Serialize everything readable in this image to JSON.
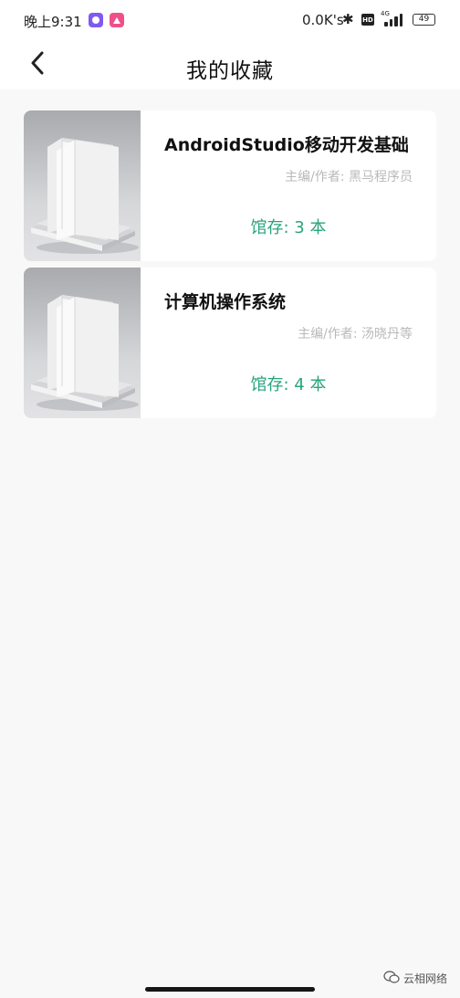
{
  "status_bar": {
    "time": "晚上9:31",
    "network_speed": "0.0K's",
    "hd_label": "HD",
    "network_type": "4G",
    "battery_level": "49"
  },
  "header": {
    "title": "我的收藏"
  },
  "books": [
    {
      "title": "AndroidStudio移动开发基础",
      "author": "主编/作者: 黑马程序员",
      "stock": "馆存: 3 本"
    },
    {
      "title": "计算机操作系统",
      "author": "主编/作者: 汤晓丹等",
      "stock": "馆存: 4 本"
    }
  ],
  "watermark": {
    "text": "云相网络"
  },
  "colors": {
    "accent_green": "#2aa37e",
    "muted_gray": "#b9b9b9",
    "background": "#f8f8f8"
  }
}
